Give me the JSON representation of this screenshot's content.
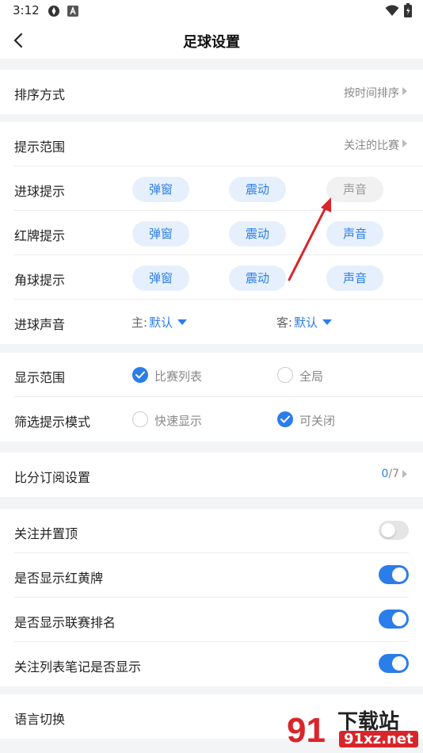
{
  "status_bar": {
    "time": "3:12"
  },
  "header": {
    "title": "足球设置"
  },
  "sort": {
    "label": "排序方式",
    "value": "按时间排序"
  },
  "alerts": {
    "scope": {
      "label": "提示范围",
      "value": "关注的比赛"
    },
    "goal": {
      "label": "进球提示",
      "options": [
        "弹窗",
        "震动",
        "声音"
      ],
      "states": [
        true,
        true,
        false
      ]
    },
    "red_card": {
      "label": "红牌提示",
      "options": [
        "弹窗",
        "震动",
        "声音"
      ],
      "states": [
        true,
        true,
        true
      ]
    },
    "corner": {
      "label": "角球提示",
      "options": [
        "弹窗",
        "震动",
        "声音"
      ],
      "states": [
        true,
        true,
        true
      ]
    },
    "goal_sound": {
      "label": "进球声音",
      "home_label": "主:",
      "home_value": "默认",
      "away_label": "客:",
      "away_value": "默认"
    }
  },
  "display": {
    "range": {
      "label": "显示范围",
      "options": [
        "比赛列表",
        "全局"
      ],
      "selected": 0
    },
    "filter_mode": {
      "label": "筛选提示模式",
      "options": [
        "快速显示",
        "可关闭"
      ],
      "selected": 1
    }
  },
  "subscription": {
    "label": "比分订阅设置",
    "count": "0",
    "total": "/7"
  },
  "toggles": [
    {
      "label": "关注并置顶",
      "on": false
    },
    {
      "label": "是否显示红黄牌",
      "on": true
    },
    {
      "label": "是否显示联赛排名",
      "on": true
    },
    {
      "label": "关注列表笔记是否显示",
      "on": true
    }
  ],
  "language": {
    "label": "语言切换"
  },
  "watermark": {
    "text": "下载站",
    "domain": "91xz.net"
  },
  "colors": {
    "accent": "#2b7de9",
    "pill_bg": "#e6f0fd",
    "annotation_arrow": "#d9252a"
  },
  "icons": [
    "back-arrow-icon",
    "chevron-right-icon",
    "dropdown-triangle-icon",
    "check-icon",
    "wifi-icon",
    "battery-icon"
  ]
}
